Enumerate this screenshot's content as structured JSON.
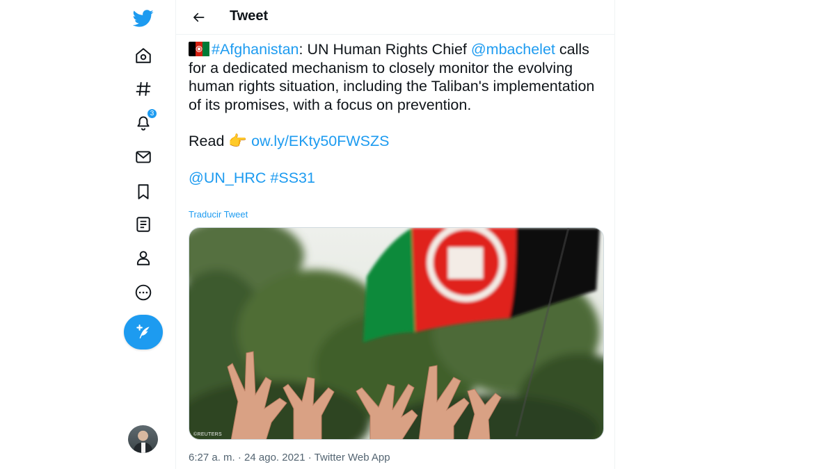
{
  "nav": {
    "notifications_badge": "3",
    "icons": [
      "twitter-logo-icon",
      "home-icon",
      "explore-hashtag-icon",
      "notifications-bell-icon",
      "messages-envelope-icon",
      "bookmarks-icon",
      "lists-icon",
      "profile-icon",
      "more-circle-icon",
      "compose-tweet-icon"
    ]
  },
  "header": {
    "title": "Tweet"
  },
  "tweet": {
    "hashtag_afghanistan": "#Afghanistan",
    "text_part1": ": UN Human Rights Chief ",
    "mention_bachelet": "@mbachelet",
    "text_part2": "calls for a dedicated mechanism to closely monitor the evolving human rights situation, including the Taliban's implementation of its promises, with a focus on prevention.",
    "read_label": "Read",
    "read_emoji": "👉",
    "link": "ow.ly/EKty50FWSZS",
    "mention_unhrc": "@UN_HRC",
    "hashtag_ss31": "#SS31",
    "translate_label": "Traducir Tweet",
    "media_watermark": "©REUTERS",
    "timestamp": "6:27 a. m. · 24 ago. 2021 · Twitter Web App"
  },
  "colors": {
    "accent": "#1d9bf0",
    "text": "#0f1419",
    "muted": "#536471",
    "border": "#eff3f4"
  }
}
